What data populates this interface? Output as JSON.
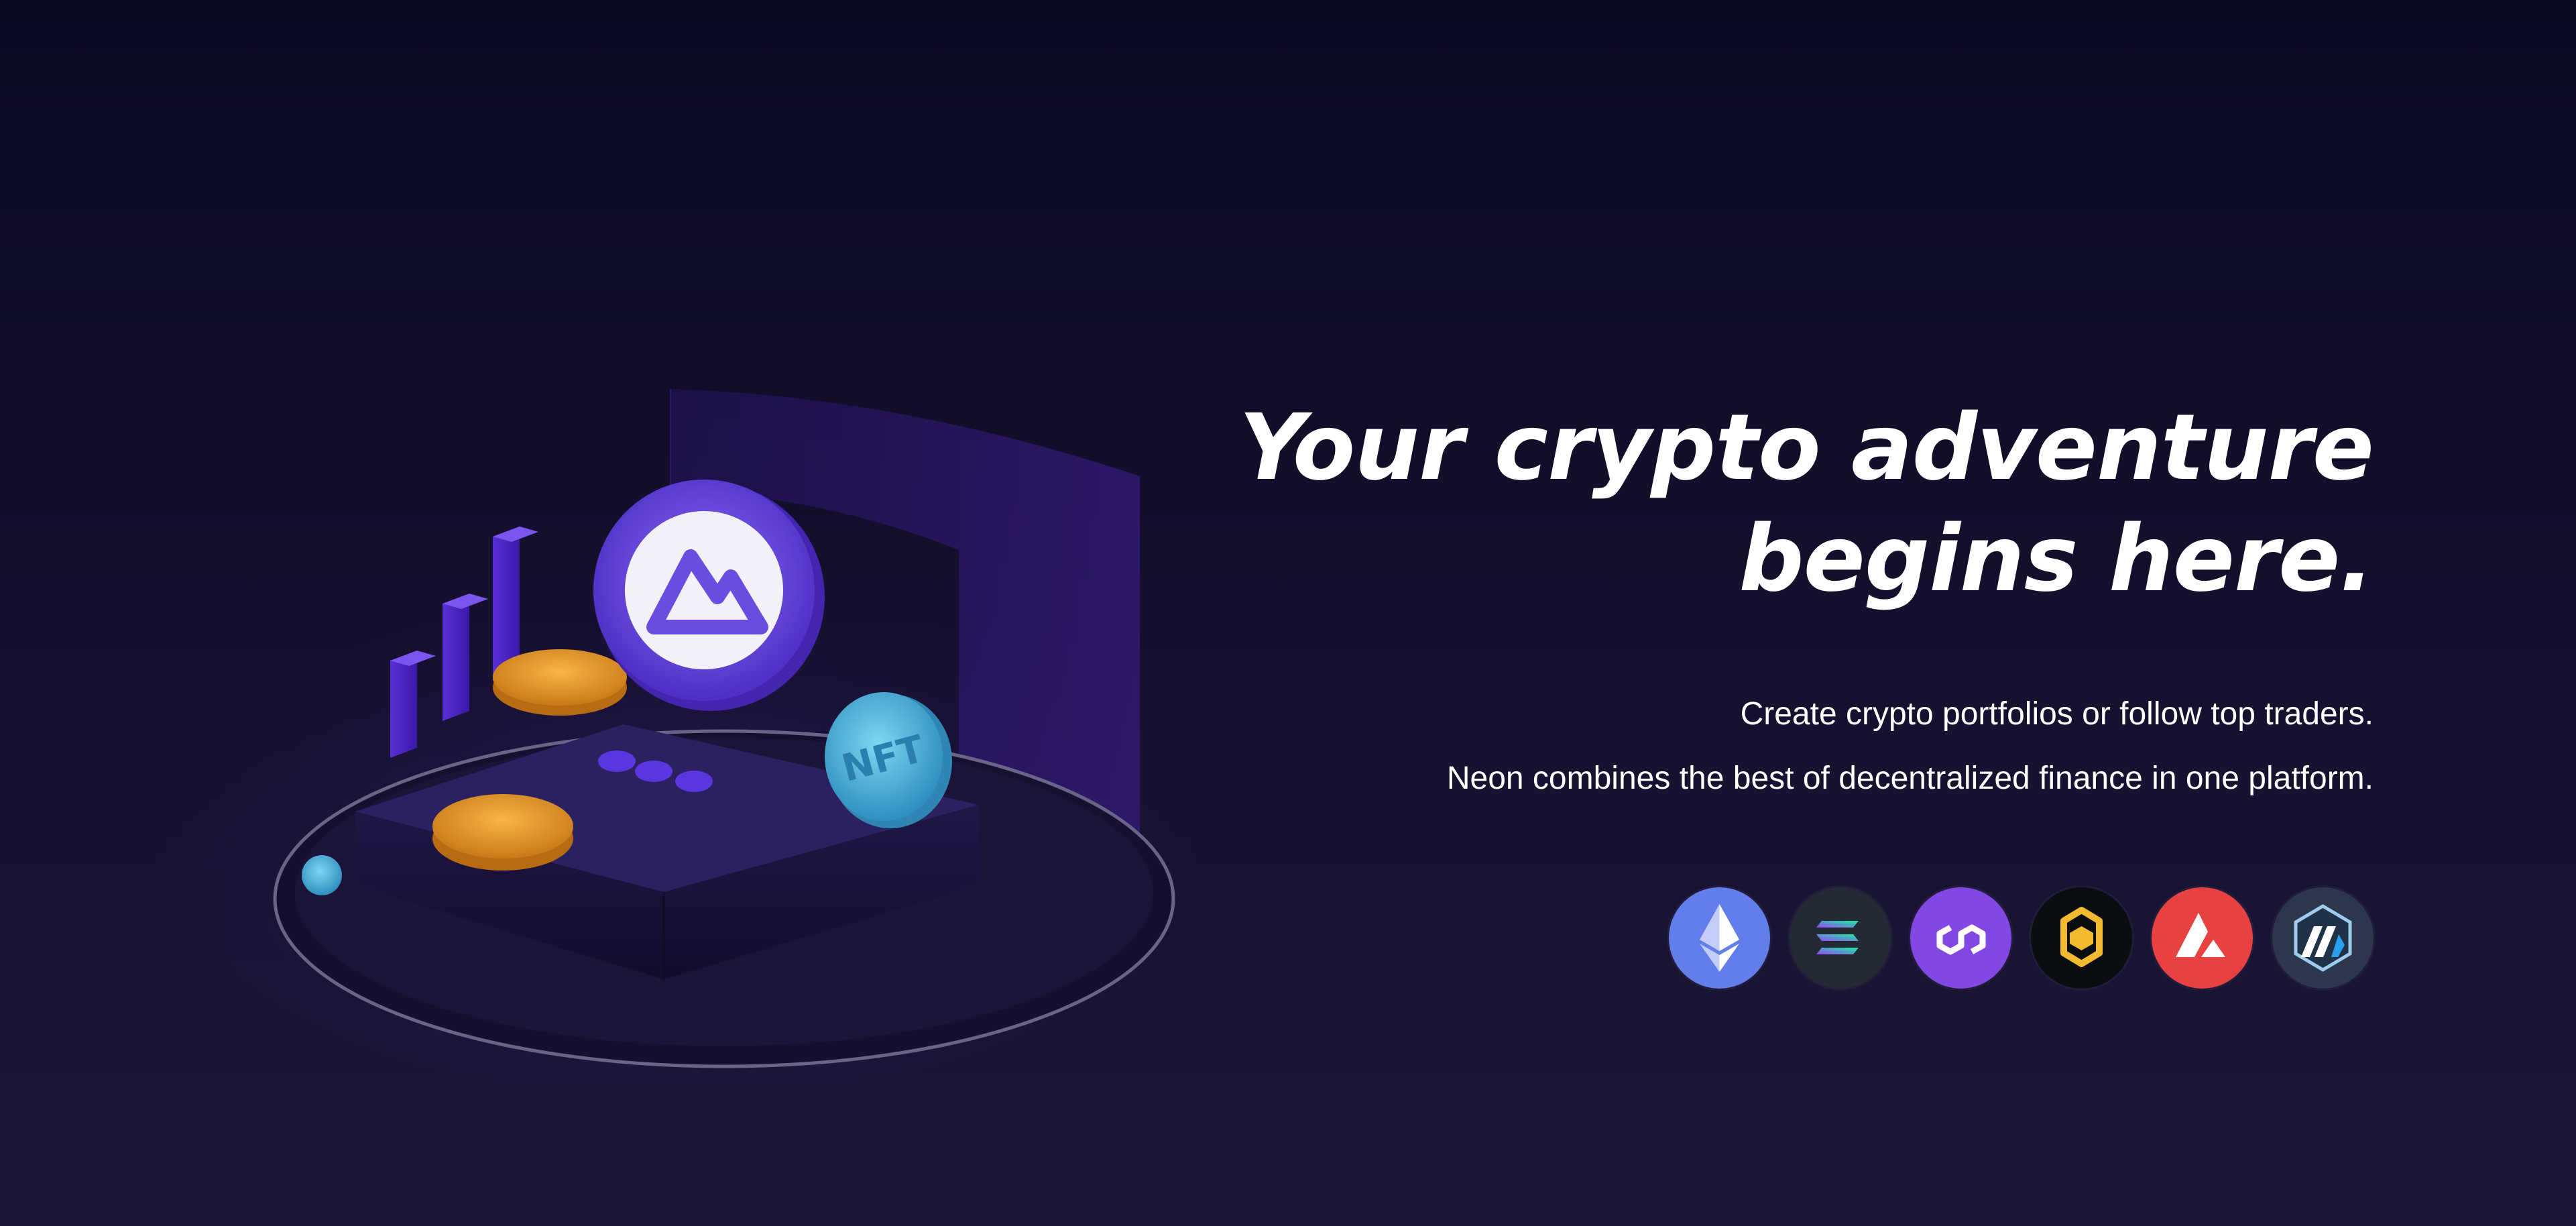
{
  "hero": {
    "headline_line1": "Your crypto adventure",
    "headline_line2": "begins here.",
    "subtitle_line1": "Create crypto portfolios or follow top traders.",
    "subtitle_line2": "Neon combines the best of decentralized finance in one platform."
  },
  "illustration": {
    "coin_label_nft": "NFT"
  },
  "chains": [
    {
      "name": "ethereum-icon",
      "color": "#627eea"
    },
    {
      "name": "solana-icon",
      "color": "#232a36"
    },
    {
      "name": "polygon-icon",
      "color": "#8247e5"
    },
    {
      "name": "bnb-icon",
      "color": "#0b0e11"
    },
    {
      "name": "avalanche-icon",
      "color": "#e84142"
    },
    {
      "name": "arbitrum-icon",
      "color": "#2d374b"
    }
  ],
  "colors": {
    "background_top": "#0a0a21",
    "background_bottom": "#1c1535",
    "accent_purple": "#5b3bd9",
    "coin_gold": "#e99a2a",
    "coin_cyan": "#4cb8e0"
  }
}
